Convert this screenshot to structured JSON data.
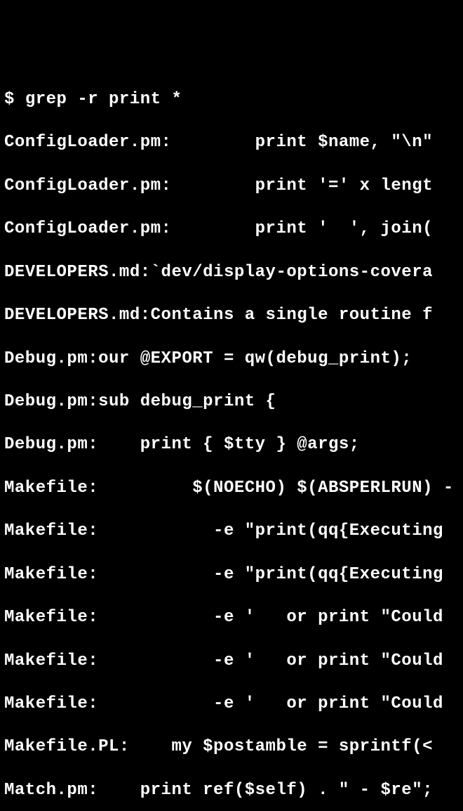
{
  "terminal": {
    "prompt": "$ ",
    "command": "grep -r print *",
    "lines": [
      "ConfigLoader.pm:        print $name, \"\\n\"",
      "ConfigLoader.pm:        print '=' x lengt",
      "ConfigLoader.pm:        print '  ', join(",
      "DEVELOPERS.md:`dev/display-options-covera",
      "DEVELOPERS.md:Contains a single routine f",
      "Debug.pm:our @EXPORT = qw(debug_print);",
      "Debug.pm:sub debug_print {",
      "Debug.pm:    print { $tty } @args;",
      "Makefile:\t  $(NOECHO) $(ABSPERLRUN) -",
      "Makefile:\t    -e \"print(qq{Executing ",
      "Makefile:\t    -e \"print(qq{Executing ",
      "Makefile:\t    -e '   or print \"Could",
      "Makefile:\t    -e '   or print \"Could",
      "Makefile:\t    -e '   or print \"Could",
      "Makefile.PL:    my $postamble = sprintf(<",
      "Match.pm:    print ref($self) . \" - $re\";"
    ]
  }
}
